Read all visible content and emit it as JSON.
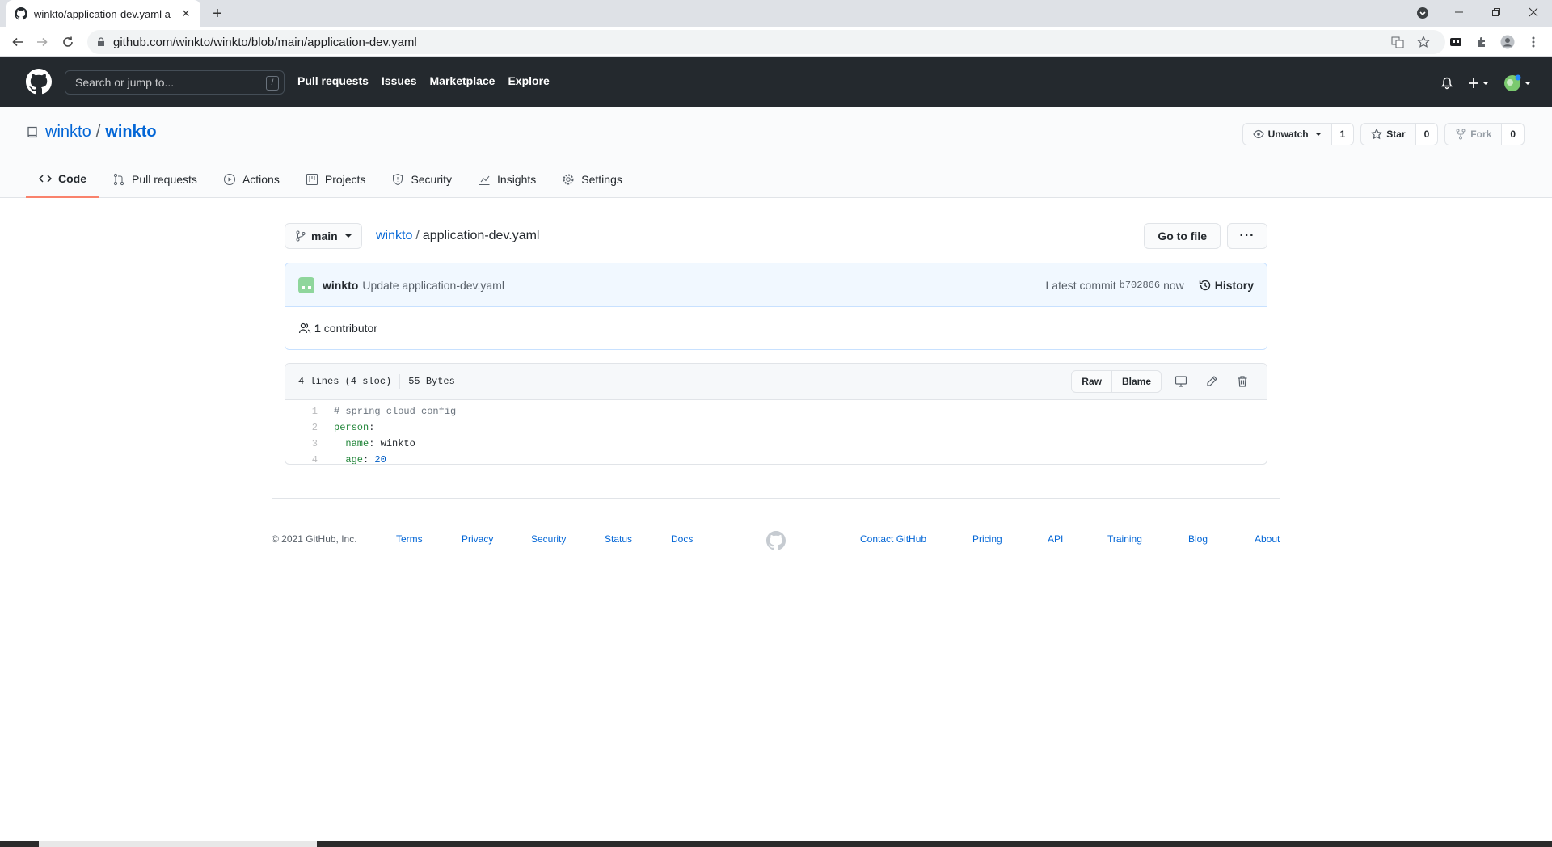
{
  "browser": {
    "tab_title": "winkto/application-dev.yaml a",
    "url": "github.com/winkto/winkto/blob/main/application-dev.yaml"
  },
  "gh_header": {
    "search_placeholder": "Search or jump to...",
    "search_shortcut": "/",
    "nav": [
      "Pull requests",
      "Issues",
      "Marketplace",
      "Explore"
    ]
  },
  "repo": {
    "owner": "winkto",
    "separator": "/",
    "name": "winkto",
    "watch_label": "Unwatch",
    "watch_count": "1",
    "star_label": "Star",
    "star_count": "0",
    "fork_label": "Fork",
    "fork_count": "0",
    "tabs": [
      "Code",
      "Pull requests",
      "Actions",
      "Projects",
      "Security",
      "Insights",
      "Settings"
    ]
  },
  "file": {
    "branch": "main",
    "crumb_repo": "winkto",
    "crumb_sep": "/",
    "filename": "application-dev.yaml",
    "goto_label": "Go to file",
    "more_label": "···",
    "commit_author": "winkto",
    "commit_message": "Update application-dev.yaml",
    "latest_label": "Latest commit",
    "commit_sha": "b702866",
    "commit_time": "now",
    "history_label": "History",
    "contributors_count": "1",
    "contributors_label": "contributor",
    "lines_info": "4 lines (4 sloc)",
    "size_info": "55 Bytes",
    "raw_label": "Raw",
    "blame_label": "Blame",
    "code": {
      "l1": "1",
      "l1_comment": "# spring cloud config",
      "l2": "2",
      "l2_key": "person",
      "l2_colon": ":",
      "l3": "3",
      "l3_indent": "  ",
      "l3_key": "name",
      "l3_colon": ": ",
      "l3_val": "winkto",
      "l4": "4",
      "l4_indent": "  ",
      "l4_key": "age",
      "l4_colon": ": ",
      "l4_val": "20"
    }
  },
  "footer": {
    "copyright": "© 2021 GitHub, Inc.",
    "left_links": [
      "Terms",
      "Privacy",
      "Security",
      "Status",
      "Docs"
    ],
    "right_links": [
      "Contact GitHub",
      "Pricing",
      "API",
      "Training",
      "Blog",
      "About"
    ]
  },
  "colors": {
    "header_bg": "#24292e",
    "link": "#0366d6",
    "tab_underline": "#f9826c",
    "commit_bg": "#f1f8ff"
  }
}
